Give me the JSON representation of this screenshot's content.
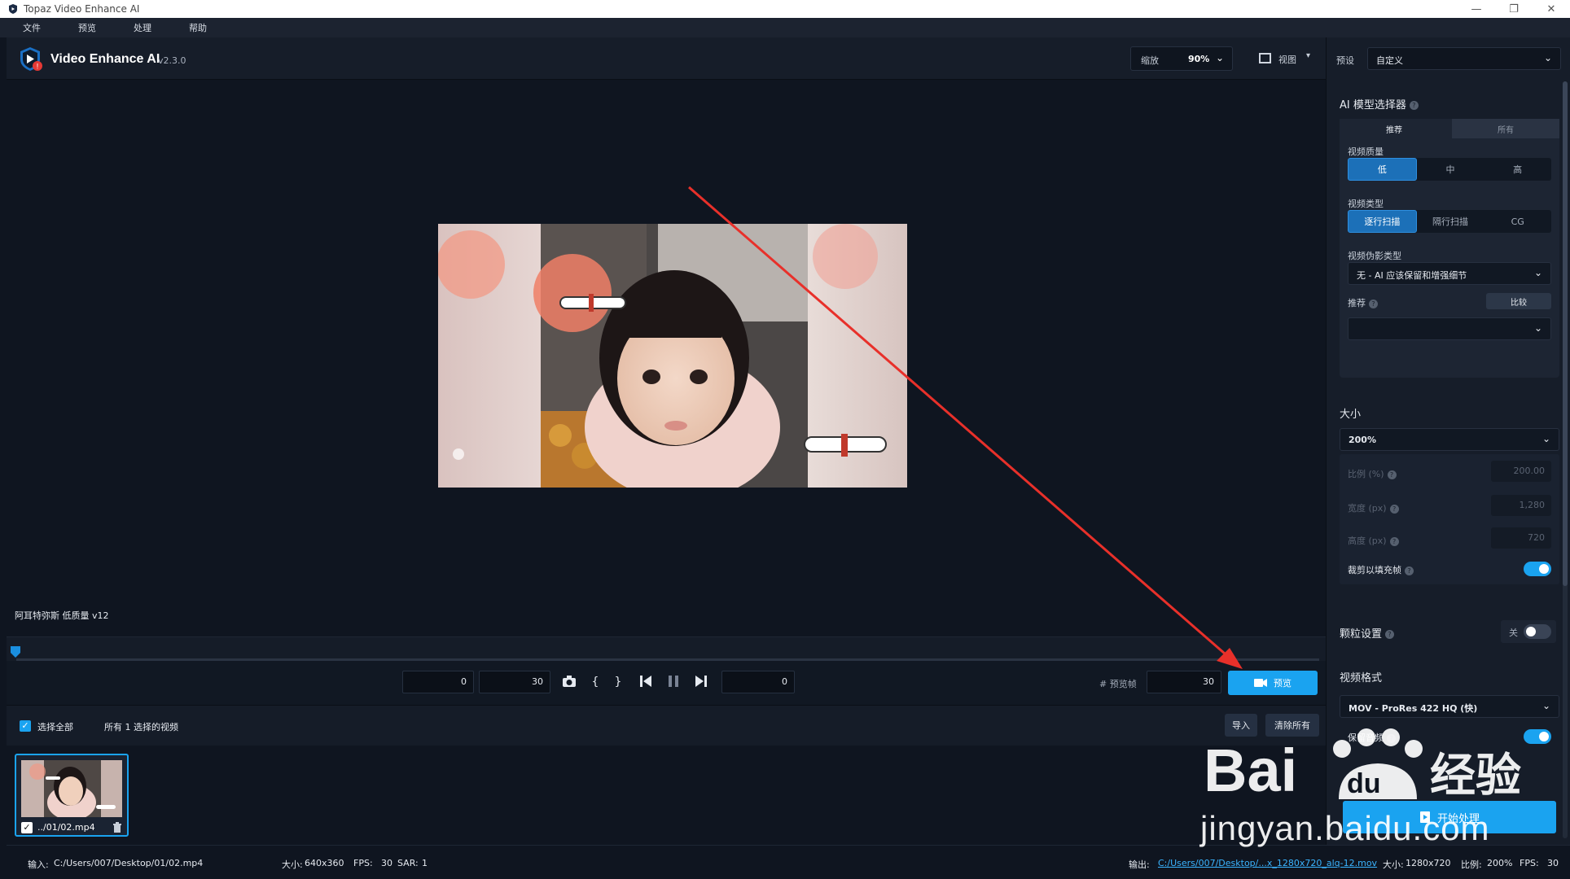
{
  "window": {
    "title": "Topaz Video Enhance AI"
  },
  "menu": {
    "items": [
      "文件",
      "预览",
      "处理",
      "帮助"
    ]
  },
  "header": {
    "app_name": "Video Enhance AI",
    "version": "v2.3.0",
    "zoom_label": "缩放",
    "zoom_value": "90%",
    "view_label": "视图"
  },
  "viewport": {
    "caption": "阿耳特弥斯 低质量 v12"
  },
  "transport": {
    "in_frame": "0",
    "out_frame": "30",
    "current_frame": "0",
    "preview_frames_label": "# 预览帧",
    "preview_frames_value": "30",
    "preview_button": "预览"
  },
  "filebar": {
    "select_all": "选择全部",
    "selection_count": "所有 1 选择的视频",
    "import_button": "导入",
    "clear_all_button": "清除所有"
  },
  "thumbnail": {
    "name": "../01/02.mp4",
    "checked": true
  },
  "status": {
    "input_label": "输入:",
    "input_path": "C:/Users/007/Desktop/01/02.mp4",
    "size_label": "大小:",
    "size_value": "640x360",
    "fps_label": "FPS:",
    "fps_value": "30",
    "sar_label": "SAR:",
    "sar_value": "1",
    "output_label": "输出:",
    "output_path": "C:/Users/007/Desktop/...x_1280x720_alq-12.mov",
    "out_size_label": "大小:",
    "out_size_value": "1280x720",
    "ratio_label": "比例:",
    "ratio_value": "200%",
    "out_fps_label": "FPS:",
    "out_fps_value": "30"
  },
  "panel": {
    "preset_label": "预设",
    "preset_value": "自定义",
    "ai_title": "AI 模型选择器",
    "tabs": [
      "推荐",
      "所有"
    ],
    "quality_label": "视频质量",
    "quality_options": [
      "低",
      "中",
      "高"
    ],
    "type_label": "视频类型",
    "type_options": [
      "逐行扫描",
      "隔行扫描",
      "CG"
    ],
    "artifact_label": "视频伪影类型",
    "artifact_value": "无 - AI 应该保留和增强细节",
    "recommend_label": "推荐",
    "compare_button": "比较",
    "recommend_value": "",
    "size_title": "大小",
    "size_value": "200%",
    "scale_label": "比例 (%)",
    "scale_value": "200.00",
    "width_label": "宽度 (px)",
    "width_value": "1,280",
    "height_label": "高度 (px)",
    "height_value": "720",
    "crop_label": "裁剪以填充帧",
    "crop_on": true,
    "grain_title": "颗粒设置",
    "grain_toggle_label": "关",
    "format_title": "视频格式",
    "format_value": "MOV - ProRes 422 HQ (快)",
    "audio_label": "保留音频",
    "audio_on": true,
    "start_button": "开始处理"
  },
  "watermark": {
    "text": "jingyan.baidu.com",
    "brand": "Baidu 经验"
  },
  "colors": {
    "accent": "#1aa3f0",
    "background": "#0f1520",
    "panel": "#161d29",
    "arrow": "#e8302a"
  }
}
